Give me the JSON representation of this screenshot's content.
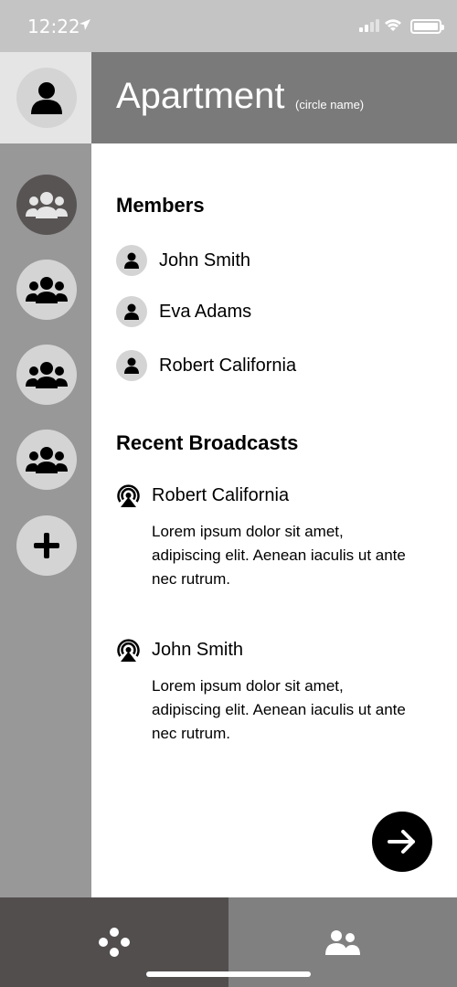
{
  "status_bar": {
    "time": "12:22"
  },
  "header": {
    "title": "Apartment",
    "subtitle": "(circle name)"
  },
  "sidebar": {
    "profile_icon": "person-icon",
    "circles": [
      {
        "icon": "group-icon",
        "active": true
      },
      {
        "icon": "group-icon",
        "active": false
      },
      {
        "icon": "group-icon",
        "active": false
      },
      {
        "icon": "group-icon",
        "active": false
      }
    ],
    "add_icon": "plus-icon"
  },
  "members": {
    "title": "Members",
    "items": [
      {
        "name": "John Smith"
      },
      {
        "name": "Eva Adams"
      },
      {
        "name": "Robert California"
      }
    ]
  },
  "broadcasts": {
    "title": "Recent Broadcasts",
    "items": [
      {
        "name": "Robert California",
        "message": "Lorem ipsum dolor sit amet, adipiscing elit. Aenean iaculis ut ante nec rutrum."
      },
      {
        "name": "John Smith",
        "message": "Lorem ipsum dolor sit amet, adipiscing elit. Aenean iaculis ut ante nec rutrum."
      }
    ]
  },
  "fab": {
    "icon": "arrow-right-icon"
  },
  "tabbar": {
    "tabs": [
      {
        "icon": "dots-icon",
        "active": true
      },
      {
        "icon": "people-icon",
        "active": false
      }
    ]
  },
  "colors": {
    "header": "#7a7a7a",
    "sidebar": "#989898",
    "active_circle": "#595454",
    "circle": "#d4d4d4",
    "tab_active": "#524e4e",
    "tab_inactive": "#808080"
  }
}
